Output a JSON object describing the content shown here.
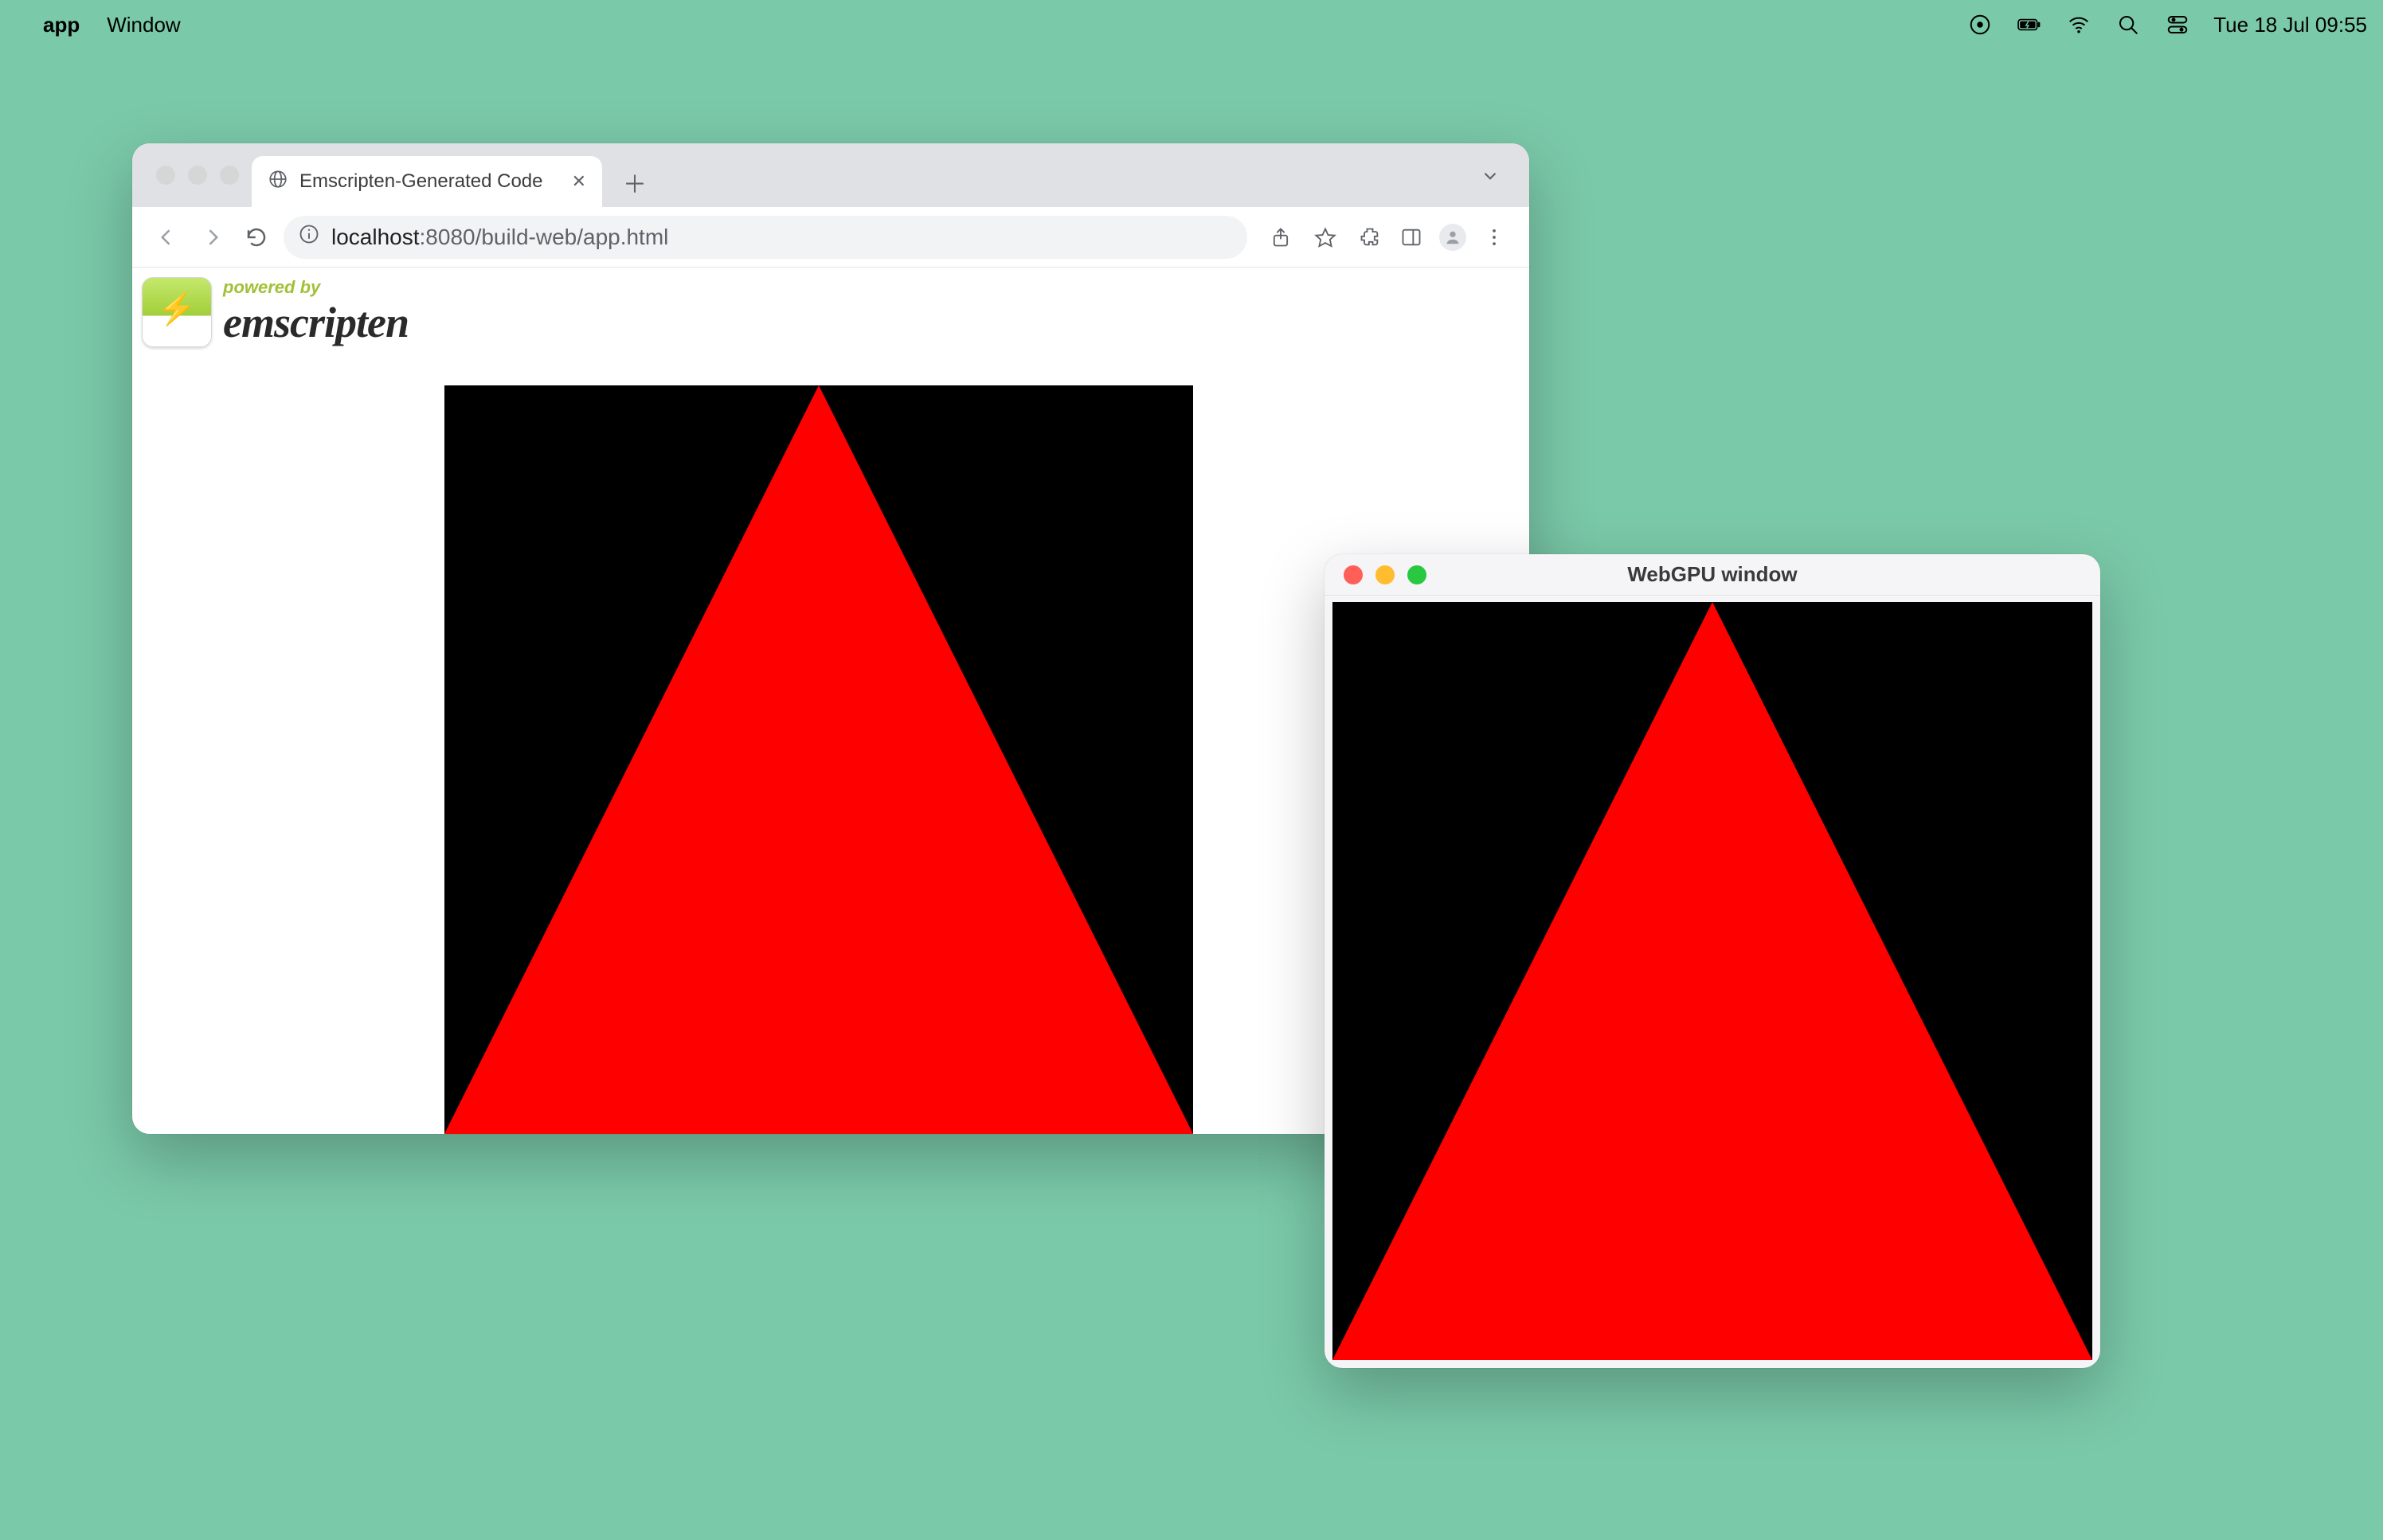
{
  "menubar": {
    "app_name": "app",
    "menu_window": "Window",
    "clock": "Tue 18 Jul  09:55"
  },
  "chrome": {
    "tab_title": "Emscripten-Generated Code",
    "url_host": "localhost",
    "url_port_path": ":8080/build-web/app.html"
  },
  "emscripten": {
    "powered_by": "powered by",
    "name": "emscripten"
  },
  "native": {
    "title": "WebGPU window"
  },
  "colors": {
    "desktop": "#7ac9a9",
    "triangle": "#ff0000",
    "canvas_bg": "#000000"
  }
}
